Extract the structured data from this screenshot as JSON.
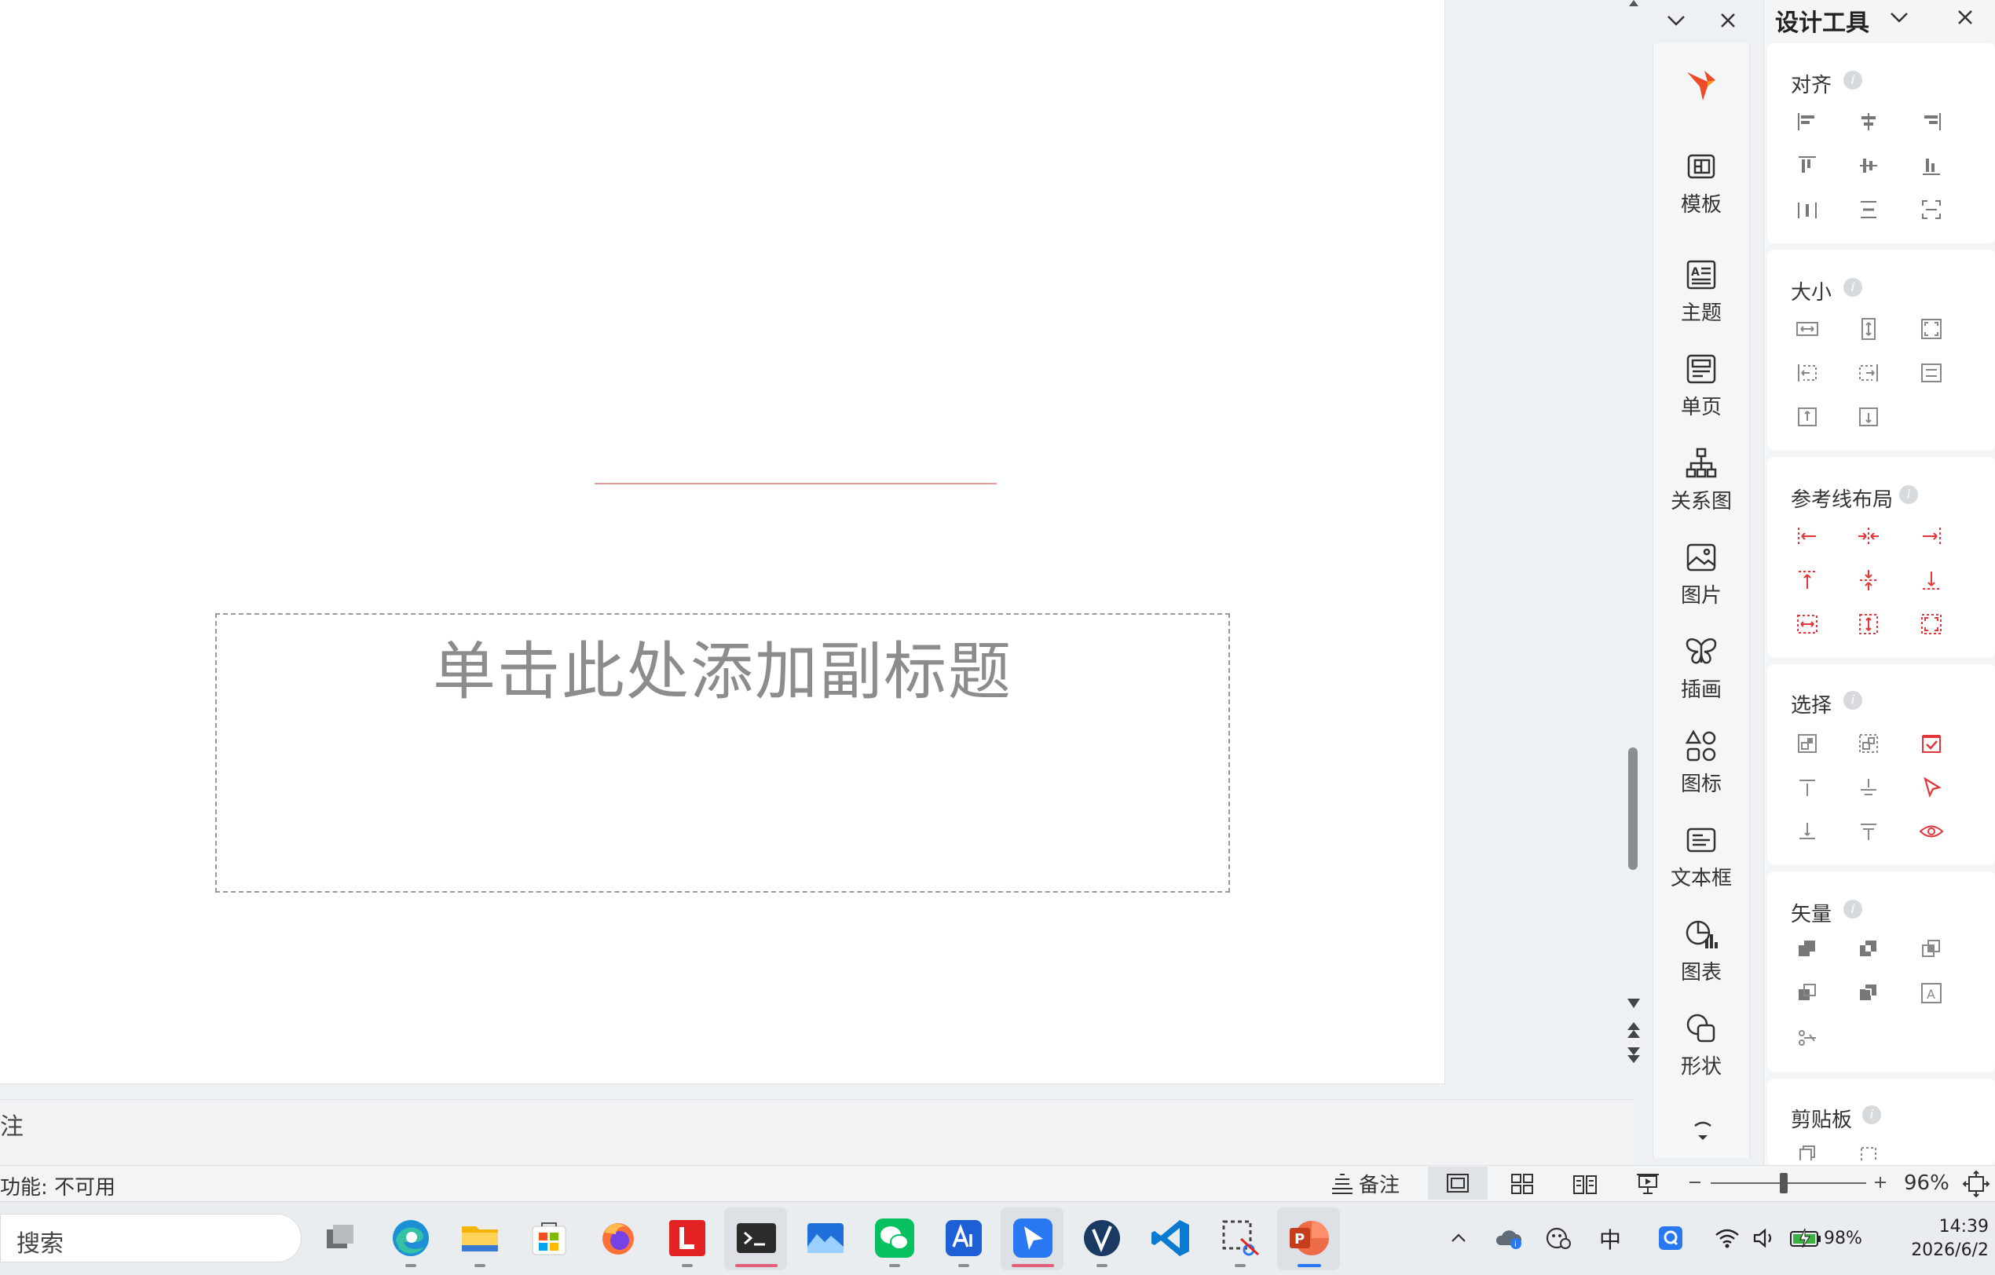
{
  "slide": {
    "subtitle_placeholder": "单击此处添加副标题"
  },
  "notes": {
    "label": "注"
  },
  "status_bar": {
    "accessibility": "功能: 不可用",
    "notes_button": "备注",
    "zoom": "96%"
  },
  "side_strip": {
    "items": [
      {
        "label": "模板",
        "icon": "template-icon"
      },
      {
        "label": "主题",
        "icon": "theme-icon"
      },
      {
        "label": "单页",
        "icon": "single-page-icon"
      },
      {
        "label": "关系图",
        "icon": "relationship-diagram-icon"
      },
      {
        "label": "图片",
        "icon": "picture-icon"
      },
      {
        "label": "插画",
        "icon": "illustration-icon"
      },
      {
        "label": "图标",
        "icon": "icons-icon"
      },
      {
        "label": "文本框",
        "icon": "textbox-icon"
      },
      {
        "label": "图表",
        "icon": "chart-icon"
      },
      {
        "label": "形状",
        "icon": "shape-icon"
      }
    ]
  },
  "design_panel": {
    "title": "设计工具",
    "sections": {
      "align": "对齐",
      "size": "大小",
      "guides": "参考线布局",
      "select": "选择",
      "vector": "矢量",
      "clipboard": "剪贴板"
    },
    "accent_color": "#e0373b"
  },
  "taskbar": {
    "search_placeholder": "搜索",
    "tray": {
      "ime": "中",
      "battery": "98%",
      "time": "14:39",
      "date": "2026/6/2"
    }
  }
}
